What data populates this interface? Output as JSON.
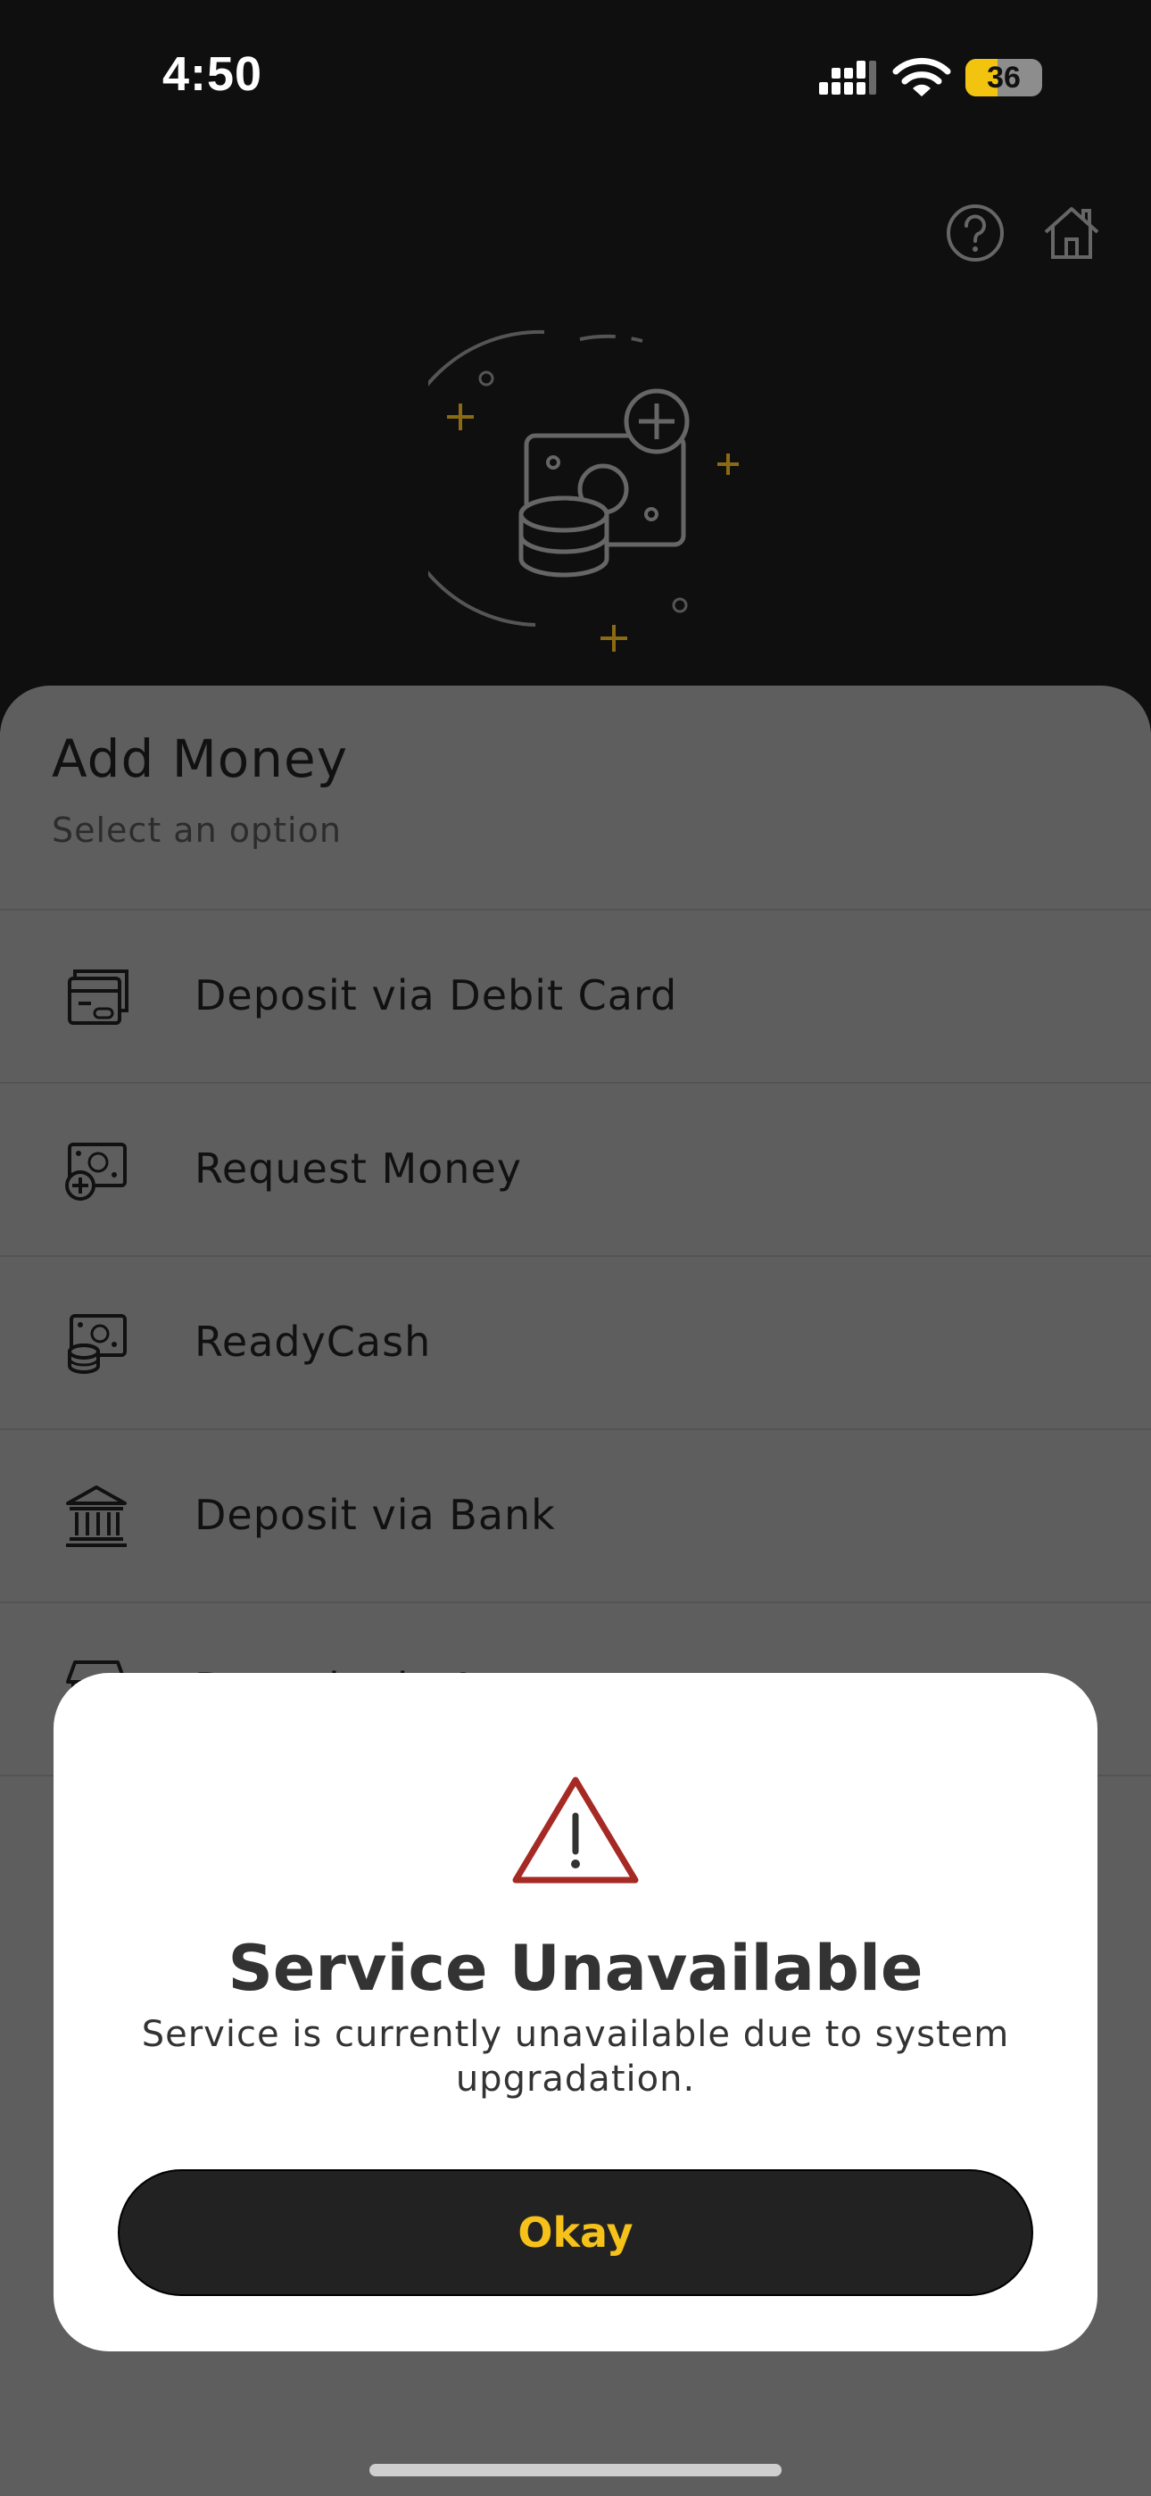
{
  "status_bar": {
    "time": "4:50",
    "battery": "36"
  },
  "header": {
    "help_icon": "question-circle-icon",
    "home_icon": "house-icon",
    "hero_icon": "add-money-illustration"
  },
  "sheet": {
    "title": "Add Money",
    "subtitle": "Select an option",
    "options": [
      {
        "label": "Deposit via Debit Card",
        "icon": "card-icon"
      },
      {
        "label": "Request Money",
        "icon": "request-money-icon"
      },
      {
        "label": "ReadyCash",
        "icon": "cash-coins-icon"
      },
      {
        "label": "Deposit via Bank",
        "icon": "bank-icon"
      },
      {
        "label": "Deposit via Agent",
        "icon": "shop-icon"
      }
    ]
  },
  "modal": {
    "icon": "warning-triangle-icon",
    "title": "Service Unavailable",
    "message": "Service is currently unavailable due to system upgradation.",
    "button_label": "Okay"
  },
  "colors": {
    "accent": "#f6c118",
    "warning": "#a52a24",
    "dark": "#0f0f0f",
    "overlay": "#5e5e5e"
  }
}
